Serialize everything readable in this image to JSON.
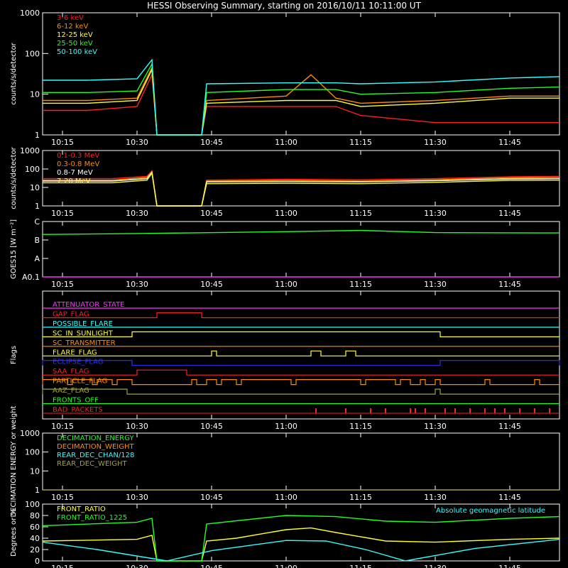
{
  "title": "HESSI Observing Summary, starting on 2016/10/11 10:11:00 UT",
  "colors": {
    "background": "#000000",
    "axes": "#ffffff",
    "red": "#ff2020",
    "orange": "#ff8c00",
    "yellow": "#ffff30",
    "green": "#20ff20",
    "cyan": "#30ffff",
    "magenta": "#ff30ff",
    "blue": "#3030ff",
    "olive": "#a0a040",
    "white": "#ffffff"
  },
  "time_axis": {
    "start": "10:11",
    "end": "11:55",
    "tick_labels": [
      "10:15",
      "10:30",
      "10:45",
      "11:00",
      "11:15",
      "11:30",
      "11:45"
    ]
  },
  "chart_data": [
    {
      "id": "lo",
      "type": "line",
      "ylabel": "counts/s/detector",
      "yscale": "log",
      "ylim": [
        1,
        1000
      ],
      "ytick_labels": [
        "1",
        "10",
        "100",
        "1000"
      ],
      "legend_position": "top-left",
      "series": [
        {
          "name": "3-6 keV",
          "color": "#ff2020",
          "points": [
            [
              "10:11",
              4
            ],
            [
              "10:20",
              4
            ],
            [
              "10:30",
              5
            ],
            [
              "10:33",
              30
            ],
            [
              "10:34",
              1
            ],
            [
              "10:43",
              1
            ],
            [
              "10:44",
              5
            ],
            [
              "11:00",
              5
            ],
            [
              "11:10",
              5
            ],
            [
              "11:15",
              3
            ],
            [
              "11:30",
              2
            ],
            [
              "11:45",
              2
            ],
            [
              "11:55",
              2
            ]
          ]
        },
        {
          "name": "6-12 keV",
          "color": "#ff8c00",
          "points": [
            [
              "10:11",
              7
            ],
            [
              "10:20",
              7
            ],
            [
              "10:30",
              8
            ],
            [
              "10:33",
              45
            ],
            [
              "10:34",
              1
            ],
            [
              "10:43",
              1
            ],
            [
              "10:44",
              7
            ],
            [
              "11:00",
              9
            ],
            [
              "11:05",
              30
            ],
            [
              "11:10",
              8
            ],
            [
              "11:15",
              6
            ],
            [
              "11:30",
              7
            ],
            [
              "11:45",
              9
            ],
            [
              "11:55",
              9
            ]
          ]
        },
        {
          "name": "12-25 keV",
          "color": "#ffff30",
          "points": [
            [
              "10:11",
              6
            ],
            [
              "10:20",
              6
            ],
            [
              "10:30",
              7
            ],
            [
              "10:33",
              40
            ],
            [
              "10:34",
              1
            ],
            [
              "10:43",
              1
            ],
            [
              "10:44",
              6
            ],
            [
              "11:00",
              7
            ],
            [
              "11:10",
              7
            ],
            [
              "11:15",
              5
            ],
            [
              "11:30",
              6
            ],
            [
              "11:45",
              8
            ],
            [
              "11:55",
              8
            ]
          ]
        },
        {
          "name": "25-50 keV",
          "color": "#20ff20",
          "points": [
            [
              "10:11",
              11
            ],
            [
              "10:20",
              11
            ],
            [
              "10:30",
              12
            ],
            [
              "10:33",
              55
            ],
            [
              "10:34",
              1
            ],
            [
              "10:43",
              1
            ],
            [
              "10:44",
              11
            ],
            [
              "11:00",
              13
            ],
            [
              "11:10",
              13
            ],
            [
              "11:15",
              10
            ],
            [
              "11:30",
              11
            ],
            [
              "11:45",
              14
            ],
            [
              "11:55",
              15
            ]
          ]
        },
        {
          "name": "50-100 keV",
          "color": "#30ffff",
          "points": [
            [
              "10:11",
              22
            ],
            [
              "10:20",
              22
            ],
            [
              "10:30",
              24
            ],
            [
              "10:33",
              70
            ],
            [
              "10:34",
              1
            ],
            [
              "10:43",
              1
            ],
            [
              "10:44",
              18
            ],
            [
              "11:00",
              19
            ],
            [
              "11:10",
              19
            ],
            [
              "11:15",
              18
            ],
            [
              "11:30",
              20
            ],
            [
              "11:45",
              25
            ],
            [
              "11:55",
              27
            ]
          ]
        }
      ]
    },
    {
      "id": "hi",
      "type": "line",
      "ylabel": "counts/s/detector",
      "yscale": "log",
      "ylim": [
        1,
        1000
      ],
      "ytick_labels": [
        "1",
        "10",
        "100",
        "1000"
      ],
      "legend_position": "top-left",
      "series": [
        {
          "name": "0.1-0.3 MeV",
          "color": "#ff2020",
          "points": [
            [
              "10:11",
              30
            ],
            [
              "10:25",
              30
            ],
            [
              "10:32",
              40
            ],
            [
              "10:33",
              80
            ],
            [
              "10:34",
              1
            ],
            [
              "10:43",
              1
            ],
            [
              "10:44",
              25
            ],
            [
              "11:00",
              28
            ],
            [
              "11:15",
              26
            ],
            [
              "11:30",
              30
            ],
            [
              "11:45",
              38
            ],
            [
              "11:55",
              40
            ]
          ]
        },
        {
          "name": "0.3-0.8 MeV",
          "color": "#ff8c00",
          "points": [
            [
              "10:11",
              25
            ],
            [
              "10:25",
              25
            ],
            [
              "10:32",
              35
            ],
            [
              "10:33",
              70
            ],
            [
              "10:34",
              1
            ],
            [
              "10:43",
              1
            ],
            [
              "10:44",
              22
            ],
            [
              "11:00",
              24
            ],
            [
              "11:15",
              22
            ],
            [
              "11:30",
              26
            ],
            [
              "11:45",
              33
            ],
            [
              "11:55",
              35
            ]
          ]
        },
        {
          "name": "0.8-7 MeV",
          "color": "#ffffff",
          "points": [
            [
              "10:11",
              22
            ],
            [
              "10:25",
              22
            ],
            [
              "10:32",
              30
            ],
            [
              "10:33",
              65
            ],
            [
              "10:34",
              1
            ],
            [
              "10:43",
              1
            ],
            [
              "10:44",
              20
            ],
            [
              "11:00",
              21
            ],
            [
              "11:15",
              20
            ],
            [
              "11:30",
              23
            ],
            [
              "11:45",
              29
            ],
            [
              "11:55",
              30
            ]
          ]
        },
        {
          "name": "7-20 MeV",
          "color": "#ffff30",
          "points": [
            [
              "10:11",
              18
            ],
            [
              "10:25",
              18
            ],
            [
              "10:32",
              25
            ],
            [
              "10:33",
              60
            ],
            [
              "10:34",
              1
            ],
            [
              "10:43",
              1
            ],
            [
              "10:44",
              16
            ],
            [
              "11:00",
              17
            ],
            [
              "11:15",
              16
            ],
            [
              "11:30",
              19
            ],
            [
              "11:45",
              24
            ],
            [
              "11:55",
              25
            ]
          ]
        }
      ]
    },
    {
      "id": "goes",
      "type": "line",
      "ylabel": "GOES15 [W m⁻²]",
      "ytick_labels": [
        "A0.1",
        "A",
        "B",
        "C"
      ],
      "ylim": [
        0,
        3
      ],
      "series": [
        {
          "color": "#20ff20",
          "points": [
            [
              "10:11",
              2.3
            ],
            [
              "10:30",
              2.35
            ],
            [
              "11:00",
              2.45
            ],
            [
              "11:15",
              2.52
            ],
            [
              "11:30",
              2.4
            ],
            [
              "11:55",
              2.38
            ]
          ]
        },
        {
          "color": "#ff30ff",
          "points": [
            [
              "10:11",
              0
            ],
            [
              "11:55",
              0
            ]
          ]
        }
      ]
    },
    {
      "id": "flags",
      "type": "line",
      "ylabel": "Flags",
      "flags": [
        {
          "name": "ATTENUATOR_STATE",
          "color": "#ff30ff",
          "intervals": []
        },
        {
          "name": "GAP_FLAG",
          "color": "#ff2020",
          "intervals": [
            [
              "10:34",
              "10:43"
            ]
          ]
        },
        {
          "name": "POSSIBLE_FLARE",
          "color": "#30ffff",
          "intervals": []
        },
        {
          "name": "SC_IN_SUNLIGHT",
          "color": "#ffff30",
          "intervals": [
            [
              "10:29",
              "11:31"
            ]
          ]
        },
        {
          "name": "SC_TRANSMITTER",
          "color": "#ff8c00",
          "intervals": []
        },
        {
          "name": "FLARE_FLAG",
          "color": "#ffff30",
          "intervals": [
            [
              "10:45",
              "10:46"
            ],
            [
              "11:05",
              "11:07"
            ],
            [
              "11:12",
              "11:14"
            ]
          ]
        },
        {
          "name": "ECLIPSE_FLAG",
          "color": "#3030ff",
          "intervals": [
            [
              "10:11",
              "10:29"
            ],
            [
              "11:31",
              "11:55"
            ]
          ]
        },
        {
          "name": "SAA_FLAG",
          "color": "#ff2020",
          "intervals": [
            [
              "10:30",
              "10:40"
            ]
          ]
        },
        {
          "name": "PARTICLE_FLAG",
          "color": "#ff8c00",
          "intervals": [
            [
              "10:11",
              "10:16"
            ],
            [
              "10:17",
              "10:21"
            ],
            [
              "10:22",
              "10:25"
            ],
            [
              "10:26",
              "10:29"
            ],
            [
              "10:41",
              "10:42"
            ],
            [
              "10:44",
              "10:46"
            ],
            [
              "10:47",
              "10:50"
            ],
            [
              "10:51",
              "11:01"
            ],
            [
              "11:02",
              "11:15"
            ],
            [
              "11:16",
              "11:22"
            ],
            [
              "11:23",
              "11:25"
            ],
            [
              "11:27",
              "11:28"
            ],
            [
              "11:30",
              "11:31"
            ],
            [
              "11:40",
              "11:41"
            ],
            [
              "11:50",
              "11:51"
            ]
          ]
        },
        {
          "name": "AAZ_FLAG",
          "color": "#a0a040",
          "intervals": [
            [
              "10:11",
              "10:28"
            ],
            [
              "11:30",
              "11:31"
            ]
          ]
        },
        {
          "name": "FRONTS_OFF",
          "color": "#20ff20",
          "intervals": []
        },
        {
          "name": "BAD_PACKETS",
          "color": "#ff2020",
          "intervals": [
            [
              "11:06",
              "11:06"
            ],
            [
              "11:12",
              "11:12"
            ],
            [
              "11:17",
              "11:17"
            ],
            [
              "11:20",
              "11:20"
            ],
            [
              "11:25",
              "11:25"
            ],
            [
              "11:26",
              "11:26"
            ],
            [
              "11:28",
              "11:28"
            ],
            [
              "11:32",
              "11:32"
            ],
            [
              "11:34",
              "11:34"
            ],
            [
              "11:37",
              "11:37"
            ],
            [
              "11:40",
              "11:40"
            ],
            [
              "11:42",
              "11:42"
            ],
            [
              "11:44",
              "11:44"
            ],
            [
              "11:47",
              "11:47"
            ],
            [
              "11:50",
              "11:50"
            ],
            [
              "11:53",
              "11:53"
            ]
          ]
        }
      ]
    },
    {
      "id": "dec",
      "type": "line",
      "ylabel": "DECIMATION ENERGY or weight",
      "yscale": "log",
      "ylim": [
        1,
        1000
      ],
      "ytick_labels": [
        "1",
        "10",
        "100",
        "1000"
      ],
      "legend_position": "top-left",
      "series": [
        {
          "name": "DECIMATION_ENERGY",
          "color": "#20ff20",
          "points": []
        },
        {
          "name": "DECIMATION_WEIGHT",
          "color": "#ff8c00",
          "points": []
        },
        {
          "name": "REAR_DEC_CHAN/128",
          "color": "#30ffff",
          "points": []
        },
        {
          "name": "REAR_DEC_WEIGHT",
          "color": "#a0a040",
          "points": [
            [
              "10:11",
              1
            ],
            [
              "11:55",
              1
            ]
          ]
        }
      ]
    },
    {
      "id": "ratio",
      "type": "line",
      "ylabel": "Degrees or %",
      "ylim": [
        0,
        100
      ],
      "ytick_labels": [
        "0",
        "20",
        "40",
        "60",
        "80",
        "100"
      ],
      "legend_position": "top-left",
      "annotation": "Absolute geomagnetic latitude",
      "series": [
        {
          "name": "FRONT_RATIO",
          "color": "#ffff30",
          "points": [
            [
              "10:11",
              35
            ],
            [
              "10:30",
              38
            ],
            [
              "10:33",
              45
            ],
            [
              "10:34",
              0
            ],
            [
              "10:43",
              0
            ],
            [
              "10:44",
              35
            ],
            [
              "10:50",
              40
            ],
            [
              "11:00",
              55
            ],
            [
              "11:05",
              58
            ],
            [
              "11:10",
              50
            ],
            [
              "11:20",
              35
            ],
            [
              "11:30",
              33
            ],
            [
              "11:45",
              38
            ],
            [
              "11:55",
              40
            ]
          ]
        },
        {
          "name": "FRONT_RATIO_1225",
          "color": "#20ff20",
          "points": [
            [
              "10:11",
              62
            ],
            [
              "10:30",
              68
            ],
            [
              "10:33",
              75
            ],
            [
              "10:34",
              0
            ],
            [
              "10:43",
              0
            ],
            [
              "10:44",
              65
            ],
            [
              "11:00",
              80
            ],
            [
              "11:10",
              78
            ],
            [
              "11:20",
              70
            ],
            [
              "11:30",
              68
            ],
            [
              "11:45",
              75
            ],
            [
              "11:55",
              78
            ]
          ]
        },
        {
          "name": "Absolute geomagnetic latitude",
          "color": "#30ffff",
          "points": [
            [
              "10:11",
              33
            ],
            [
              "10:22",
              20
            ],
            [
              "10:36",
              0
            ],
            [
              "10:45",
              18
            ],
            [
              "11:00",
              36
            ],
            [
              "11:08",
              35
            ],
            [
              "11:16",
              20
            ],
            [
              "11:24",
              0
            ],
            [
              "11:38",
              22
            ],
            [
              "11:55",
              38
            ]
          ]
        }
      ]
    }
  ]
}
